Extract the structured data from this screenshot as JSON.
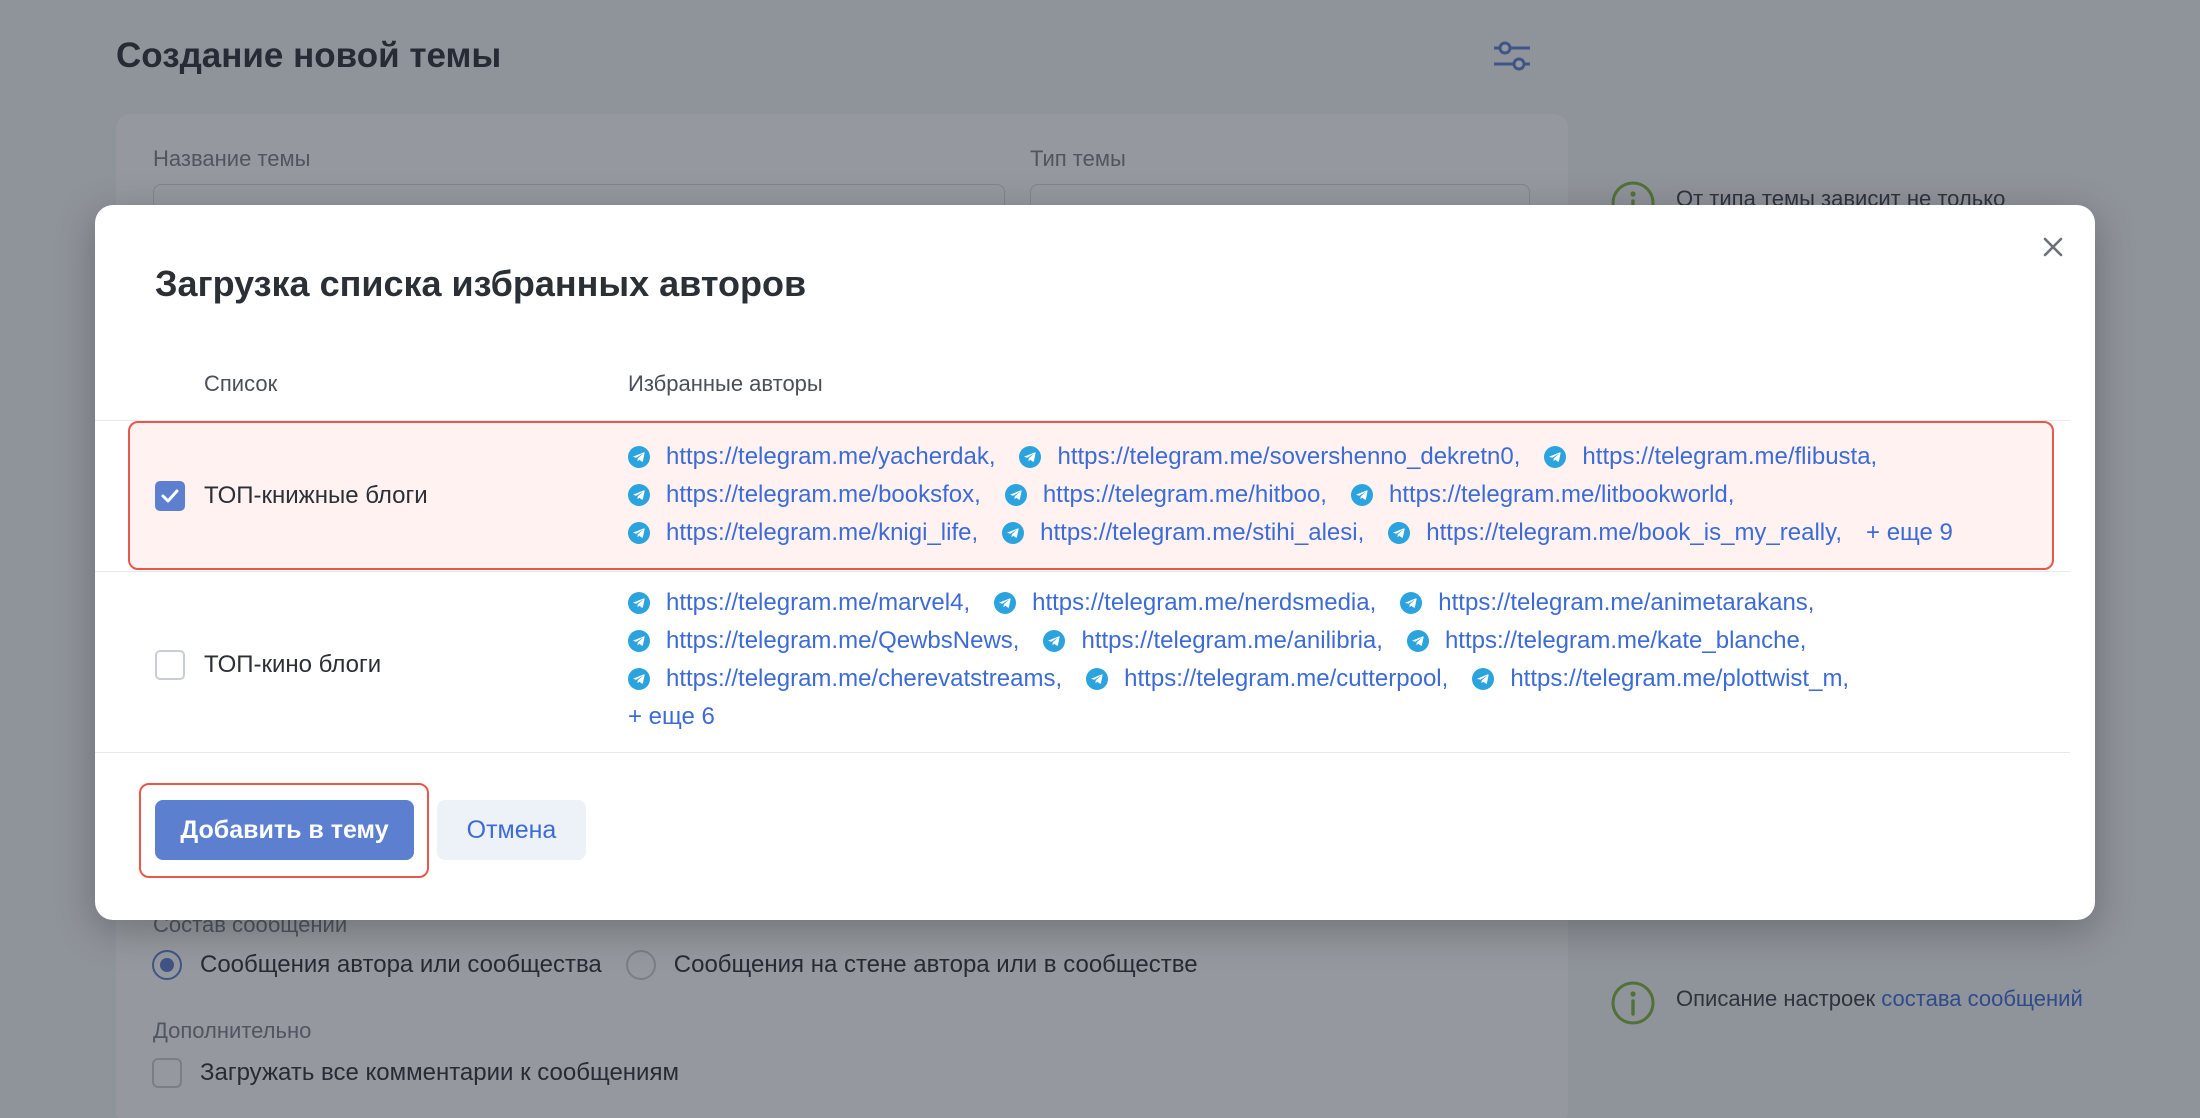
{
  "background": {
    "page_title": "Создание новой темы",
    "name_label": "Название темы",
    "type_label": "Тип темы",
    "side_note_top": "От типа темы зависит не только",
    "composition_label": "Состав сообщений",
    "radio_options": [
      "Сообщения автора или сообщества",
      "Сообщения на стене автора или в сообществе"
    ],
    "additional_label": "Дополнительно",
    "load_comments_label": "Загружать все комментарии к сообщениям",
    "side_note_bottom": "Описание настроек",
    "side_note_bottom_link": "состава сообщений"
  },
  "modal": {
    "title": "Загрузка списка избранных авторов",
    "columns": {
      "list": "Список",
      "authors": "Избранные авторы"
    },
    "rows": [
      {
        "name": "ТОП-книжные блоги",
        "checked": true,
        "lines": [
          [
            "https://telegram.me/yacherdak,",
            "https://telegram.me/sovershenno_dekretn0,",
            "https://telegram.me/flibusta,"
          ],
          [
            "https://telegram.me/booksfox,",
            "https://telegram.me/hitboo,",
            "https://telegram.me/litbookworld,"
          ],
          [
            "https://telegram.me/knigi_life,",
            "https://telegram.me/stihi_alesi,",
            "https://telegram.me/book_is_my_really,"
          ]
        ],
        "more": "+ еще 9"
      },
      {
        "name": "ТОП-кино блоги",
        "checked": false,
        "lines": [
          [
            "https://telegram.me/marvel4,",
            "https://telegram.me/nerdsmedia,",
            "https://telegram.me/animetarakans,"
          ],
          [
            "https://telegram.me/QewbsNews,",
            "https://telegram.me/anilibria,",
            "https://telegram.me/kate_blanche,"
          ],
          [
            "https://telegram.me/cherevatstreams,",
            "https://telegram.me/cutterpool,",
            "https://telegram.me/plottwist_m,"
          ]
        ],
        "more": "+ еще 6"
      }
    ],
    "add_button": "Добавить в тему",
    "cancel_button": "Отмена"
  },
  "colors": {
    "accent": "#5d7fd0",
    "link": "#3d6bd6",
    "highlight": "#e8574a",
    "telegram": "#2aa3de"
  }
}
